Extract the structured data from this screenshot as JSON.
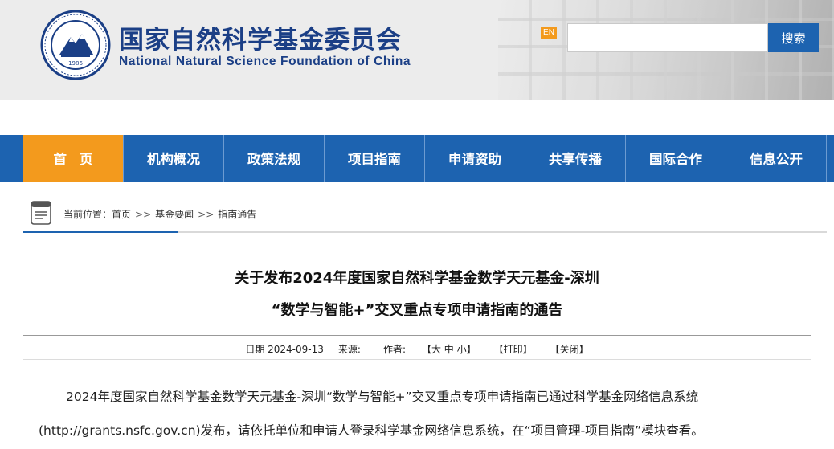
{
  "header": {
    "title": "国家自然科学基金委员会",
    "subtitle": "National Natural Science Foundation of China",
    "logo_year": "1986",
    "en_label": "EN",
    "search_placeholder": "",
    "search_button": "搜索"
  },
  "nav": {
    "items": [
      {
        "label": "首页"
      },
      {
        "label": "机构概况"
      },
      {
        "label": "政策法规"
      },
      {
        "label": "项目指南"
      },
      {
        "label": "申请资助"
      },
      {
        "label": "共享传播"
      },
      {
        "label": "国际合作"
      },
      {
        "label": "信息公开"
      }
    ]
  },
  "breadcrumb": {
    "prefix": "当前位置：",
    "items": [
      "首页",
      "基金要闻",
      "指南通告"
    ],
    "separator": ">>"
  },
  "article": {
    "title_line1": "关于发布2024年度国家自然科学基金数学天元基金-深圳",
    "title_line2": "“数学与智能+”交叉重点专项申请指南的通告",
    "meta": {
      "date": "日期 2024-09-13",
      "source": "来源:",
      "author": "作者:",
      "font_size": "【大 中 小】",
      "print": "【打印】",
      "close": "【关闭】"
    },
    "paragraph_line1": "2024年度国家自然科学基金数学天元基金-深圳“数学与智能+”交叉重点专项申请指南已通过科学基金网络信息系统",
    "paragraph_line2": "(http://grants.nsfc.gov.cn)发布，请依托单位和申请人登录科学基金网络信息系统，在“项目管理-项目指南”模块查看。"
  },
  "colors": {
    "primary_blue": "#1d63b0",
    "accent_orange": "#f39a1d",
    "title_blue": "#1b3f86"
  }
}
